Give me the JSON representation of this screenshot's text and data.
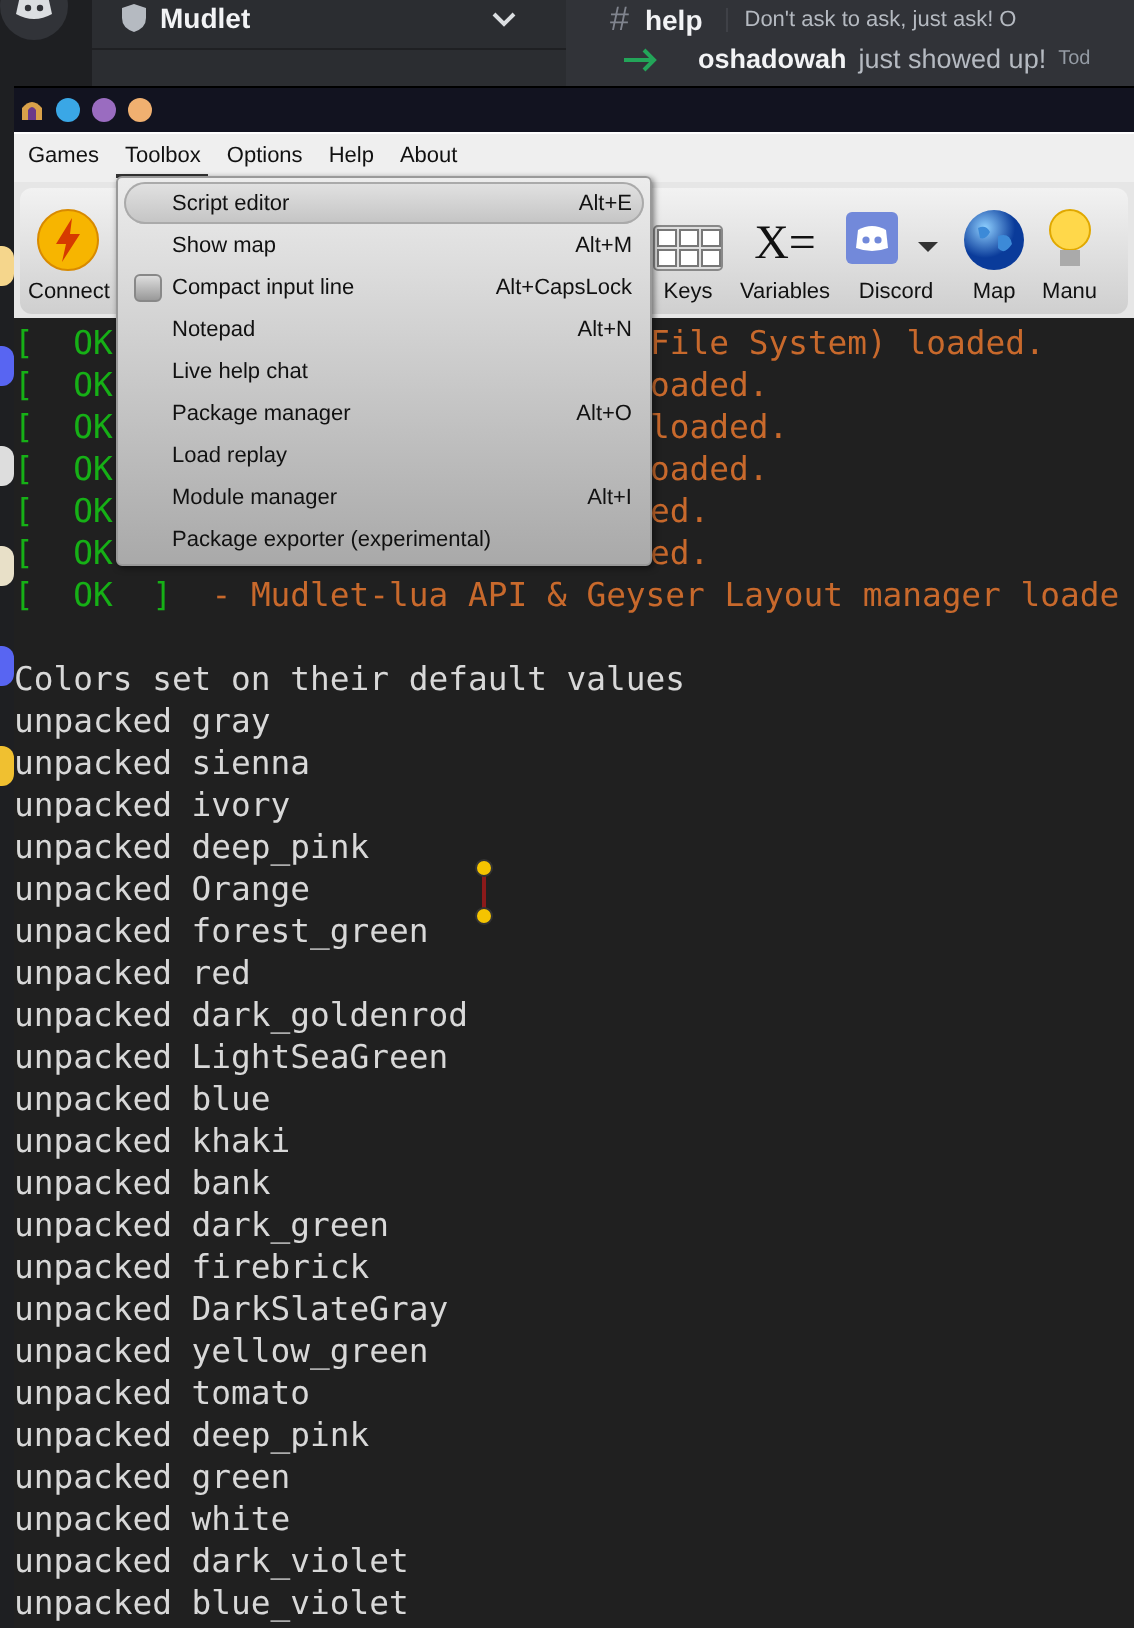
{
  "background_chat": {
    "server_name": "Mudlet",
    "channel_icon": "#",
    "channel": "help",
    "topic": "Don't ask to ask, just ask! O",
    "message": {
      "user": "oshadowah",
      "text": "just showed up!",
      "time": "Tod"
    }
  },
  "menu_bar": [
    {
      "label": "Games",
      "selected": false
    },
    {
      "label": "Toolbox",
      "selected": true
    },
    {
      "label": "Options",
      "selected": false
    },
    {
      "label": "Help",
      "selected": false
    },
    {
      "label": "About",
      "selected": false
    }
  ],
  "toolbar": [
    {
      "label": "Connect",
      "kind": "connect"
    },
    {
      "label": "Keys",
      "kind": "keys"
    },
    {
      "label": "Variables",
      "kind": "variables",
      "glyph": "X="
    },
    {
      "label": "Discord",
      "kind": "discord"
    },
    {
      "label": "Map",
      "kind": "map"
    },
    {
      "label": "Manu",
      "kind": "bulb"
    }
  ],
  "toolbox_menu": [
    {
      "label": "Script editor",
      "shortcut": "Alt+E",
      "selected": true
    },
    {
      "label": "Show map",
      "shortcut": "Alt+M",
      "selected": false
    },
    {
      "label": "Compact input line",
      "shortcut": "Alt+CapsLock",
      "selected": false,
      "checked": false
    },
    {
      "label": "Notepad",
      "shortcut": "Alt+N",
      "selected": false
    },
    {
      "label": "Live help chat",
      "selected": false
    },
    {
      "label": "Package manager",
      "shortcut": "Alt+O",
      "selected": false
    },
    {
      "label": "Load replay",
      "selected": false
    },
    {
      "label": "Module manager",
      "shortcut": "Alt+I",
      "selected": false
    },
    {
      "label": "Package exporter (experimental)",
      "selected": false
    }
  ],
  "console": [
    {
      "kind": "status",
      "status": "[  OK",
      "tail": "File System) loaded."
    },
    {
      "kind": "status",
      "status": "[  OK",
      "tail": "oaded."
    },
    {
      "kind": "status",
      "status": "[  OK",
      "tail": "loaded."
    },
    {
      "kind": "status",
      "status": "[  OK",
      "tail": "oaded."
    },
    {
      "kind": "status",
      "status": "[  OK",
      "tail": "ed."
    },
    {
      "kind": "status",
      "status": "[  OK",
      "tail": "ed."
    },
    {
      "kind": "status_full",
      "status": "[  OK  ]",
      "text": "- Mudlet-lua API & Geyser Layout manager loade"
    },
    {
      "kind": "blank"
    },
    {
      "kind": "plain",
      "text": "Colors set on their default values"
    },
    {
      "kind": "plain",
      "text": "unpacked gray"
    },
    {
      "kind": "plain",
      "text": "unpacked sienna"
    },
    {
      "kind": "plain",
      "text": "unpacked ivory"
    },
    {
      "kind": "plain",
      "text": "unpacked deep_pink"
    },
    {
      "kind": "plain",
      "text": "unpacked Orange"
    },
    {
      "kind": "plain",
      "text": "unpacked forest_green"
    },
    {
      "kind": "plain",
      "text": "unpacked red"
    },
    {
      "kind": "plain",
      "text": "unpacked dark_goldenrod"
    },
    {
      "kind": "plain",
      "text": "unpacked LightSeaGreen"
    },
    {
      "kind": "plain",
      "text": "unpacked blue"
    },
    {
      "kind": "plain",
      "text": "unpacked khaki"
    },
    {
      "kind": "plain",
      "text": "unpacked bank"
    },
    {
      "kind": "plain",
      "text": "unpacked dark_green"
    },
    {
      "kind": "plain",
      "text": "unpacked firebrick"
    },
    {
      "kind": "plain",
      "text": "unpacked DarkSlateGray"
    },
    {
      "kind": "plain",
      "text": "unpacked yellow_green"
    },
    {
      "kind": "plain",
      "text": "unpacked tomato"
    },
    {
      "kind": "plain",
      "text": "unpacked deep_pink"
    },
    {
      "kind": "plain",
      "text": "unpacked green"
    },
    {
      "kind": "plain",
      "text": "unpacked white"
    },
    {
      "kind": "plain",
      "text": "unpacked dark_violet"
    },
    {
      "kind": "plain",
      "text": "unpacked blue_violet"
    }
  ]
}
